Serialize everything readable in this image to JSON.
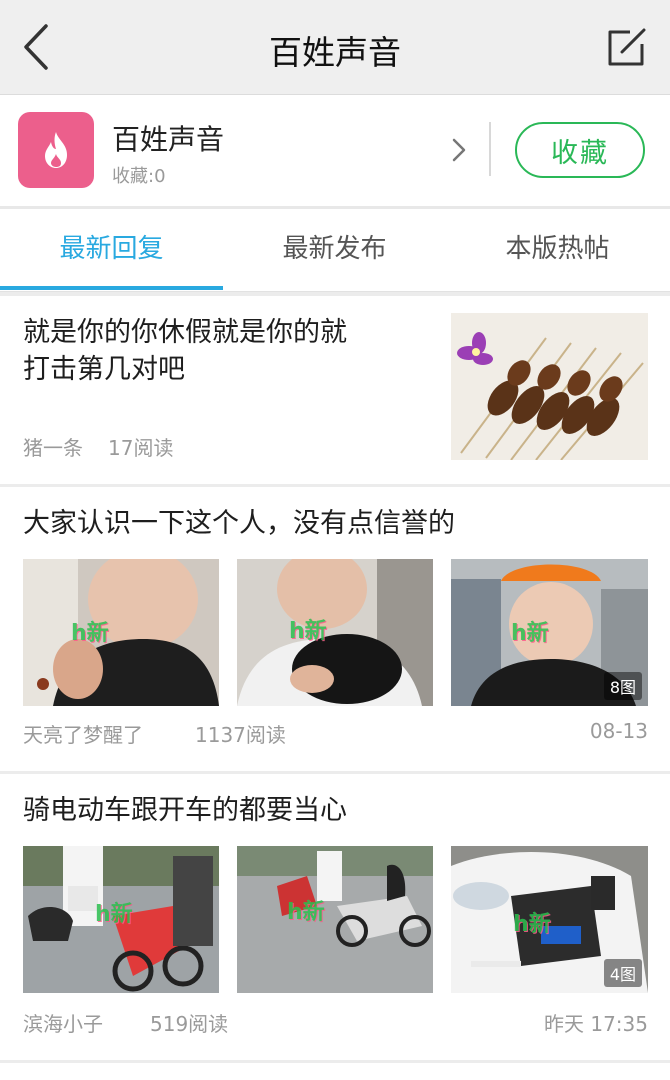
{
  "nav": {
    "title": "百姓声音"
  },
  "forum": {
    "name": "百姓声音",
    "fav_count": "收藏:0",
    "fav_button": "收藏"
  },
  "tabs": [
    {
      "label": "最新回复",
      "active": true
    },
    {
      "label": "最新发布",
      "active": false
    },
    {
      "label": "本版热帖",
      "active": false
    }
  ],
  "posts": [
    {
      "title_line1": "就是你的你休假就是你的就",
      "title_line2": "打击第几对吧",
      "author": "猪一条",
      "reads": "17阅读"
    },
    {
      "title": "大家认识一下这个人，没有点信誉的",
      "author": "天亮了梦醒了",
      "reads": "1137阅读",
      "date": "08-13",
      "image_count": "8图"
    },
    {
      "title": "骑电动车跟开车的都要当心",
      "author": "滨海小子",
      "reads": "519阅读",
      "date": "昨天 17:35",
      "image_count": "4图"
    }
  ],
  "colors": {
    "accent": "#29a9e0",
    "fav_green": "#2ab857",
    "logo_pink": "#ec5f8c"
  },
  "icons": [
    "back-arrow-icon",
    "edit-icon",
    "flame-icon",
    "chevron-right-icon"
  ]
}
